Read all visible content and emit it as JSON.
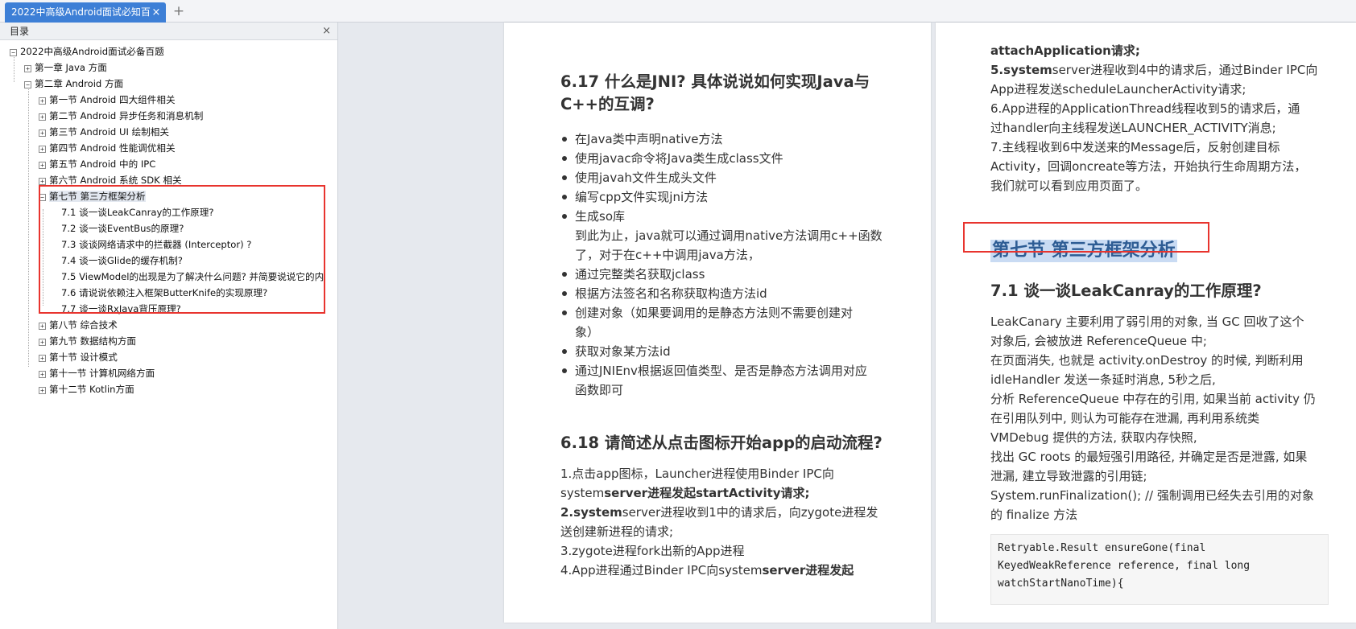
{
  "tab": {
    "title": "2022中高级Android面试必知百",
    "close": "×",
    "add": "+"
  },
  "sidebar": {
    "title": "目录",
    "close": "×",
    "tree": [
      {
        "label": "2022中高级Android面试必备百题",
        "level": 0,
        "exp": "−"
      },
      {
        "label": "第一章 Java 方面",
        "level": 1,
        "exp": "+"
      },
      {
        "label": "第二章 Android 方面",
        "level": 1,
        "exp": "−"
      },
      {
        "label": "第一节 Android 四大组件相关",
        "level": 2,
        "exp": "+"
      },
      {
        "label": "第二节 Android 异步任务和消息机制",
        "level": 2,
        "exp": "+"
      },
      {
        "label": "第三节 Android UI 绘制相关",
        "level": 2,
        "exp": "+"
      },
      {
        "label": "第四节 Android 性能调优相关",
        "level": 2,
        "exp": "+"
      },
      {
        "label": "第五节 Android 中的 IPC",
        "level": 2,
        "exp": "+"
      },
      {
        "label": "第六节 Android 系统 SDK 相关",
        "level": 2,
        "exp": "+"
      },
      {
        "label": "第七节 第三方框架分析",
        "level": 2,
        "exp": "−",
        "selected": true
      },
      {
        "label": "7.1 谈一谈LeakCanray的工作原理?",
        "level": 3
      },
      {
        "label": "7.2 谈一谈EventBus的原理?",
        "level": 3
      },
      {
        "label": "7.3 谈谈网络请求中的拦截器 (Interceptor) ?",
        "level": 3
      },
      {
        "label": "7.4 谈一谈Glide的缓存机制?",
        "level": 3
      },
      {
        "label": "7.5 ViewModel的出现是为了解决什么问题? 并简要说说它的内",
        "level": 3
      },
      {
        "label": "7.6 请说说依赖注入框架ButterKnife的实现原理?",
        "level": 3
      },
      {
        "label": "7.7 谈一谈RxJava背压原理?",
        "level": 3
      },
      {
        "label": "第八节 综合技术",
        "level": 2,
        "exp": "+"
      },
      {
        "label": "第九节 数据结构方面",
        "level": 2,
        "exp": "+"
      },
      {
        "label": "第十节 设计模式",
        "level": 2,
        "exp": "+"
      },
      {
        "label": "第十一节 计算机网络方面",
        "level": 2,
        "exp": "+"
      },
      {
        "label": "第十二节 Kotlin方面",
        "level": 2,
        "exp": "+"
      }
    ]
  },
  "left_page": {
    "h617_line1": "6.17 什么是JNI? 具体说说如何实现Java与",
    "h617_line2": "C++的互调?",
    "bullets": [
      {
        "text": "在Java类中声明native方法"
      },
      {
        "text": "使用javac命令将Java类生成class文件"
      },
      {
        "text": "使用javah文件生成头文件"
      },
      {
        "text": "编写cpp文件实现jni方法"
      },
      {
        "text": "生成so库",
        "sub1": "到此为止，java就可以通过调用native方法调用c++函数",
        "sub2": "了，对于在c++中调用java方法，"
      },
      {
        "text": "通过完整类名获取jclass"
      },
      {
        "text": "根据方法签名和名称获取构造方法id"
      },
      {
        "text": "创建对象（如果要调用的是静态方法则不需要创建对",
        "sub1": "象）"
      },
      {
        "text": "获取对象某方法id"
      },
      {
        "text": "通过JNIEnv根据返回值类型、是否是静态方法调用对应",
        "sub1": "函数即可"
      }
    ],
    "h618": "6.18 请简述从点击图标开始app的启动流程?",
    "flow": {
      "l1": "1.点击app图标，Launcher进程使用Binder IPC向",
      "l2a": "system",
      "l2b": "server进程发起startActivity请求;",
      "l3a": "2.system",
      "l3b": "server进程收到1中的请求后，向zygote进程发",
      "l4": "送创建新进程的请求;",
      "l5": "3.zygote进程fork出新的App进程",
      "l6a": "4.App进程通过Binder IPC向system",
      "l6b": "server进程发起"
    }
  },
  "right_page": {
    "p1": "attachApplication请求;",
    "p2a": "5.system",
    "p2b": "server进程收到4中的请求后，通过Binder IPC向",
    "p3": "App进程发送scheduleLauncherActivity请求;",
    "p4": "6.App进程的ApplicationThread线程收到5的请求后，通",
    "p5": "过handler向主线程发送LAUNCHER_ACTIVITY消息;",
    "p6": "7.主线程收到6中发送来的Message后，反射创建目标",
    "p7": "Activity，回调oncreate等方法，开始执行生命周期方法，",
    "p8": "我们就可以看到应用页面了。",
    "section_title": "第七节 第三方框架分析",
    "h71": "7.1 谈一谈LeakCanray的工作原理?",
    "body": [
      "LeakCanary 主要利用了弱引用的对象, 当 GC 回收了这个",
      "对象后, 会被放进 ReferenceQueue 中;",
      "在页面消失, 也就是 activity.onDestroy 的时候, 判断利用",
      "idleHandler 发送一条延时消息, 5秒之后,",
      "分析 ReferenceQueue 中存在的引用, 如果当前 activity 仍",
      "在引用队列中, 则认为可能存在泄漏, 再利用系统类",
      "VMDebug 提供的方法, 获取内存快照,",
      "找出 GC roots 的最短强引用路径, 并确定是否是泄露, 如果",
      "泄漏, 建立导致泄露的引用链;",
      "System.runFinalization(); // 强制调用已经失去引用的对象",
      "的 finalize 方法"
    ],
    "code": [
      "Retryable.Result ensureGone(final",
      "KeyedWeakReference reference, final long",
      "watchStartNanoTime){"
    ]
  }
}
